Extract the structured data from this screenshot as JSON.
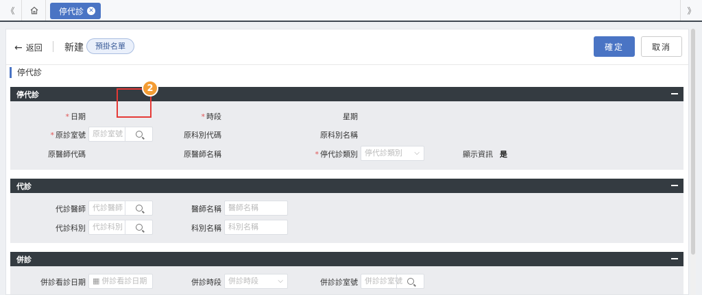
{
  "topbar": {
    "collapse_left": "《",
    "collapse_right": "》",
    "active_tab": "停代診"
  },
  "header": {
    "back_label": "返回",
    "title": "新建",
    "badge": "預掛名單",
    "confirm_label": "確定",
    "cancel_label": "取消"
  },
  "section_title": "停代診",
  "groups": {
    "stop": {
      "title": "停代診",
      "date_label": "日期",
      "period_label": "時段",
      "weekday_label": "星期",
      "room_label": "原診室號",
      "room_placeholder": "原診室號",
      "dept_code_label": "原科別代碼",
      "dept_name_label": "原科別名稱",
      "doctor_code_label": "原醫師代碼",
      "doctor_name_label": "原醫師名稱",
      "type_label": "停代診類別",
      "type_placeholder": "停代診類別",
      "display_label": "顯示資訊",
      "display_value": "是"
    },
    "sub": {
      "title": "代診",
      "doctor_label": "代診醫師",
      "doctor_placeholder": "代診醫師",
      "doctor_name_label": "醫師名稱",
      "doctor_name_placeholder": "醫師名稱",
      "dept_label": "代診科別",
      "dept_placeholder": "代診科別",
      "dept_name_label": "科別名稱",
      "dept_name_placeholder": "科別名稱"
    },
    "merge": {
      "title": "併診",
      "date_label": "併診看診日期",
      "date_placeholder": "併診看診日期",
      "period_label": "併診時段",
      "period_placeholder": "併診時段",
      "room_label": "併診診室號",
      "room_placeholder": "併診診室號"
    }
  },
  "annotation": {
    "step": "2",
    "color": "#f39c34",
    "box_color": "#e53935"
  },
  "colors": {
    "primary": "#4a74c4",
    "group_header": "#343b41",
    "required": "#e05555"
  }
}
